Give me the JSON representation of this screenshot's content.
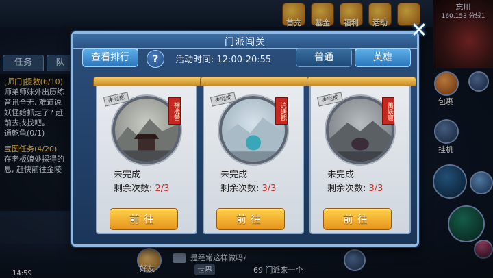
{
  "modal": {
    "title": "门派闯关",
    "rank_button": "查看排行",
    "help_icon": "?",
    "activity_time": "活动时间: 12:00-20:55",
    "mode_normal": "普通",
    "mode_hero": "英雄",
    "close_icon": "✕",
    "panels": [
      {
        "seal": "神機營",
        "stamp": "未完成",
        "status": "未完成",
        "remaining_label": "剩余次数: ",
        "remaining": "2/3",
        "go": "前往"
      },
      {
        "seal": "逍遥觀",
        "stamp": "未完成",
        "status": "未完成",
        "remaining_label": "剩余次数: ",
        "remaining": "3/3",
        "go": "前往"
      },
      {
        "seal": "萬妖窟",
        "stamp": "未完成",
        "status": "未完成",
        "remaining_label": "剩余次数: ",
        "remaining": "3/3",
        "go": "前往"
      }
    ]
  },
  "hud": {
    "minimap_title": "忘川",
    "minimap_coords": "160,153 分线1",
    "task_tab": "任务",
    "team_tab": "队",
    "task_lines": [
      "[师门]援救(6/10)",
      "师弟师妹外出历练",
      "音讯全无, 难道说",
      "妖怪给抓走了? 赶",
      "前去找找吧。",
      "通乾龟(0/1)",
      "",
      "宝图任务(4/20)",
      "在老板娘处探得的",
      "息, 赶快前往金陵"
    ],
    "top_icon_labels": [
      "首充",
      "基金",
      "福利",
      "活动",
      ""
    ],
    "pack_label": "包裹",
    "hang_label": "挂机",
    "friends_label": "好友",
    "world_label": "世界",
    "chat_1": "是经常这样做吗?",
    "chat_2": "69 门派来一个",
    "clock": "14:59"
  }
}
